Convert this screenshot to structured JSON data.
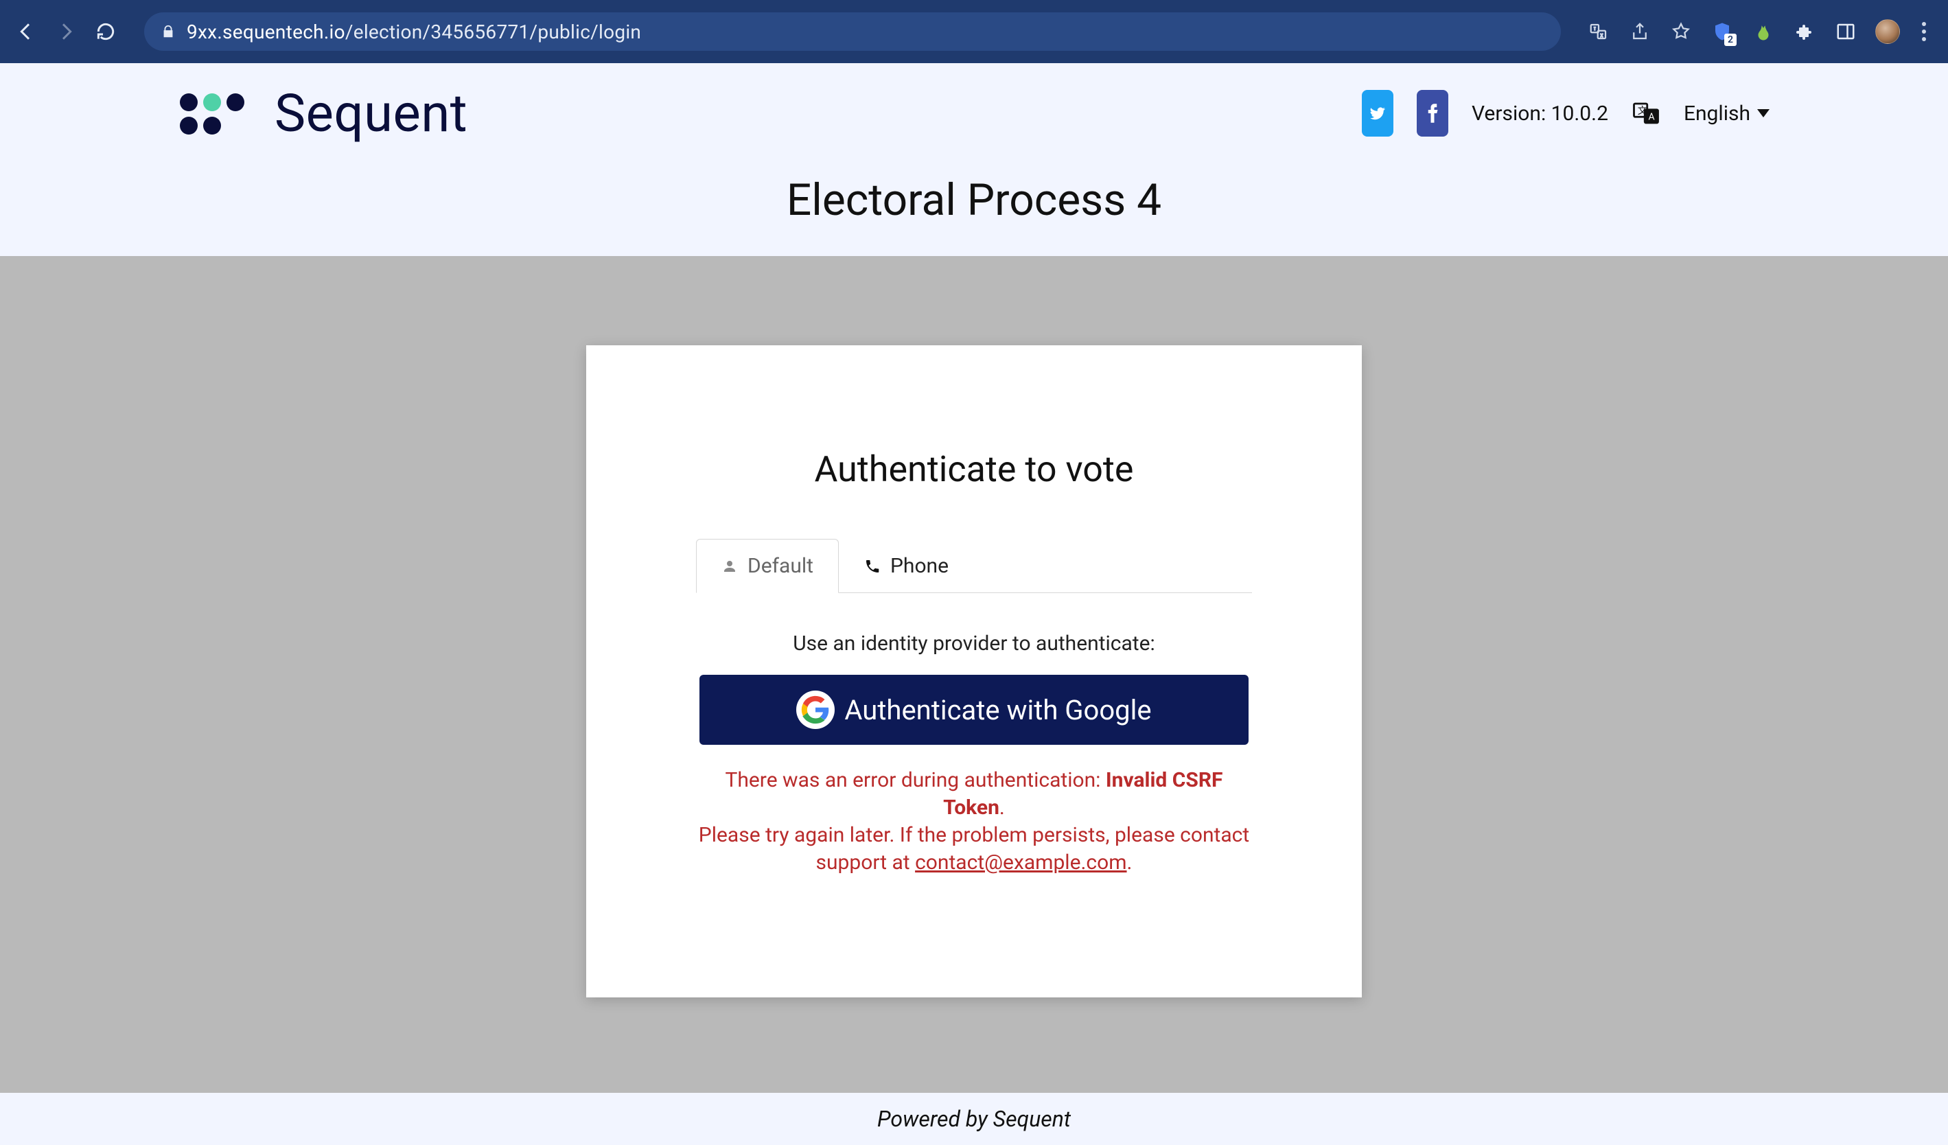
{
  "browser": {
    "url_domain": "9xx.sequentech.io",
    "url_path": "/election/345656771/public/login",
    "ext_badge": "2"
  },
  "header": {
    "logo_text": "Sequent",
    "version": "Version: 10.0.2",
    "language": "English"
  },
  "page": {
    "title": "Electoral Process 4"
  },
  "card": {
    "title": "Authenticate to vote",
    "tabs": {
      "default": "Default",
      "phone": "Phone"
    },
    "use_idp": "Use an identity provider to authenticate:",
    "google_btn": "Authenticate with Google",
    "error": {
      "line1_pre": "There was an error during authentication: ",
      "line1_bold": "Invalid CSRF Token",
      "line1_post": ".",
      "line2_pre": "Please try again later. If the problem persists, please contact support at ",
      "email": "contact@example.com",
      "line2_post": "."
    }
  },
  "footer": {
    "text": "Powered by Sequent"
  }
}
